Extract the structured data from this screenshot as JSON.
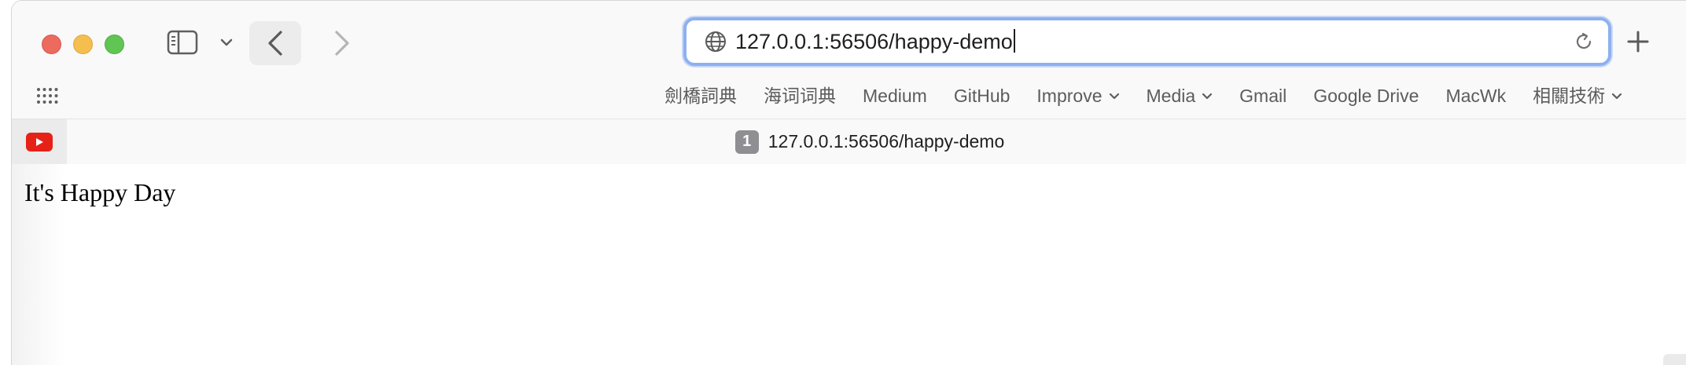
{
  "address_bar": {
    "url": "127.0.0.1:56506/happy-demo",
    "icon": "globe-icon"
  },
  "bookmarks": [
    {
      "label": "劍橋詞典",
      "has_menu": false
    },
    {
      "label": "海词词典",
      "has_menu": false
    },
    {
      "label": "Medium",
      "has_menu": false
    },
    {
      "label": "GitHub",
      "has_menu": false
    },
    {
      "label": "Improve",
      "has_menu": true
    },
    {
      "label": "Media",
      "has_menu": true
    },
    {
      "label": "Gmail",
      "has_menu": false
    },
    {
      "label": "Google Drive",
      "has_menu": false
    },
    {
      "label": "MacWk",
      "has_menu": false
    },
    {
      "label": "相關技術",
      "has_menu": true
    }
  ],
  "tabs": {
    "pinned": {
      "icon": "youtube-icon"
    },
    "active": {
      "badge": "1",
      "title": "127.0.0.1:56506/happy-demo"
    }
  },
  "page": {
    "text": "It's Happy Day"
  },
  "colors": {
    "focus_ring": "#8fb0ef",
    "close": "#ed6a5e",
    "minimize": "#f5bf4f",
    "zoom": "#61c554",
    "youtube": "#e62117"
  }
}
